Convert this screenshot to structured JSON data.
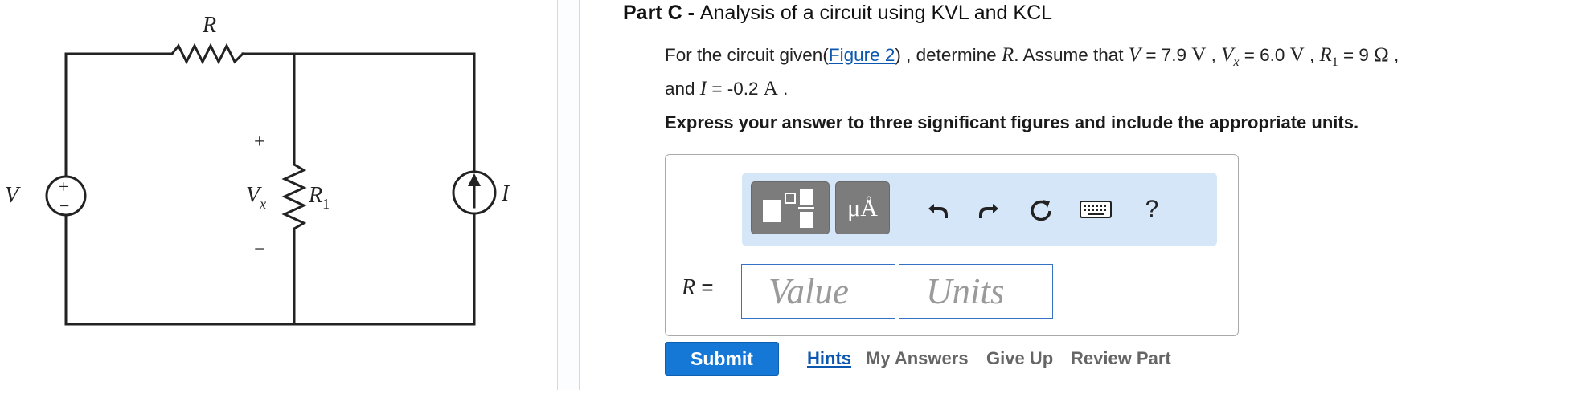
{
  "figure": {
    "label_R": "R",
    "label_V": "V",
    "label_Vx_main": "V",
    "label_Vx_sub": "x",
    "label_R1_main": "R",
    "label_R1_sub": "1",
    "label_I": "I",
    "plus_sign": "+",
    "minus_sign": "−",
    "source_plus": "+",
    "source_minus": "−"
  },
  "part": {
    "label": "Part C - ",
    "title": "Analysis of a circuit using KVL and KCL"
  },
  "prompt": {
    "t1": "For the circuit given(",
    "link": "Figure 2",
    "t2": ") , determine ",
    "R": "R",
    "t3": ". Assume that ",
    "V": "V",
    "t4": " = 7.9 ",
    "V_unit": "V",
    "t5": " , ",
    "Vx": "V",
    "Vx_sub": "x",
    "t6": " = 6.0 ",
    "Vx_unit": "V",
    "t7": " , ",
    "R1": "R",
    "R1_sub": "1",
    "t8": " = 9 ",
    "R1_unit": "Ω",
    "t9": " ,",
    "t10": "and ",
    "I": "I",
    "t11": " = -0.2 ",
    "I_unit": "A",
    "t12": " ."
  },
  "instruction": "Express your answer to three significant figures and include the appropriate units.",
  "toolbar": {
    "units_label": "μÅ",
    "help_label": "?",
    "icons": [
      "fraction-template-icon",
      "units-icon",
      "undo-icon",
      "redo-icon",
      "reset-icon",
      "keyboard-icon",
      "help-icon"
    ]
  },
  "answer": {
    "label_var": "R",
    "label_eq": " =",
    "value_placeholder": "Value",
    "units_placeholder": "Units"
  },
  "footer": {
    "submit": "Submit",
    "hints": "Hints",
    "my_answers": "My Answers",
    "give_up": "Give Up",
    "review_part": "Review Part"
  },
  "colors": {
    "accent": "#1578d6",
    "toolbar_bg": "#d6e6f9",
    "link": "#0b57b0",
    "input_border": "#3571c6"
  }
}
